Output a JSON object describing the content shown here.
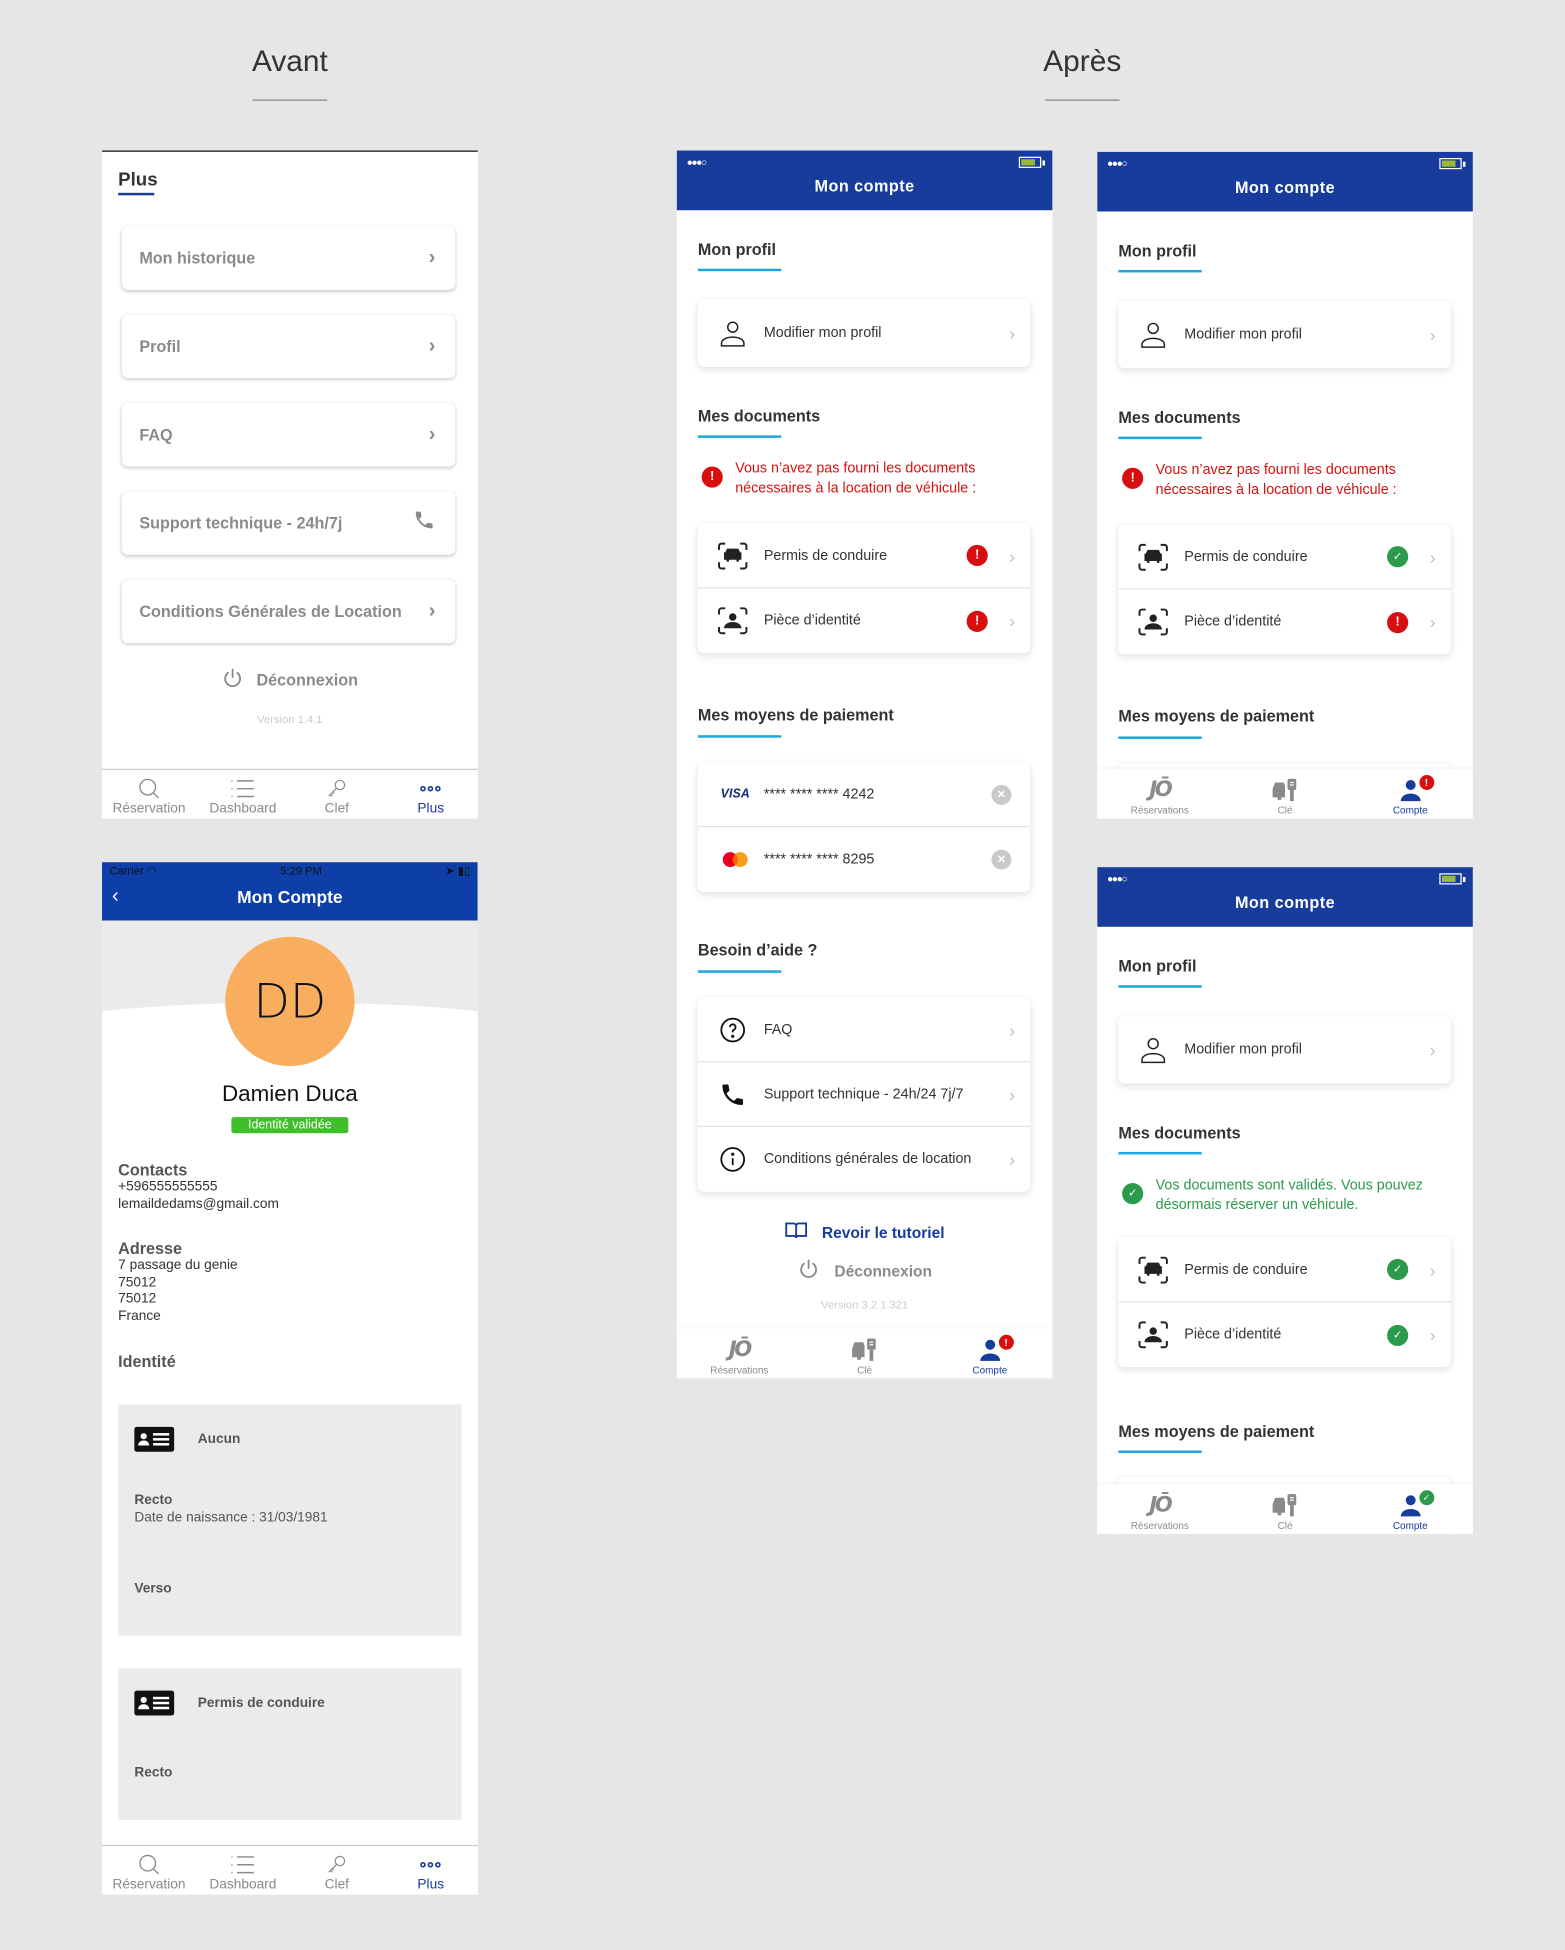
{
  "headings": {
    "before": "Avant",
    "after": "Après"
  },
  "colors": {
    "brand_blue": "#173c9c",
    "accent_cyan": "#1aa6df",
    "error_red": "#d90f0f",
    "success_green": "#2b9a4a",
    "avatar_orange": "#f9ad5f",
    "badge_green": "#3fbf2a"
  },
  "avant_plus": {
    "title": "Plus",
    "items": [
      {
        "label": "Mon historique",
        "icon": "chevron-right-icon"
      },
      {
        "label": "Profil",
        "icon": "chevron-right-icon"
      },
      {
        "label": "FAQ",
        "icon": "chevron-right-icon"
      },
      {
        "label": "Support technique - 24h/7j",
        "icon": "phone-icon"
      },
      {
        "label": "Conditions Générales de Location",
        "icon": "chevron-right-icon"
      }
    ],
    "logout": "Déconnexion",
    "version": "Version 1.4.1",
    "tabs": [
      {
        "label": "Réservation",
        "icon": "search-icon"
      },
      {
        "label": "Dashboard",
        "icon": "list-icon"
      },
      {
        "label": "Clef",
        "icon": "key-icon"
      },
      {
        "label": "Plus",
        "icon": "more-icon",
        "active": true
      }
    ]
  },
  "avant_compte": {
    "status_bar": {
      "carrier": "Carrier",
      "time": "5:29 PM"
    },
    "title": "Mon Compte",
    "avatar_initials": "DD",
    "name": "Damien Duca",
    "badge": "Identité validée",
    "contacts": {
      "heading": "Contacts",
      "phone": "+596555555555",
      "email": "lemaildedams@gmail.com"
    },
    "address": {
      "heading": "Adresse",
      "lines": [
        "7 passage du genie",
        "75012",
        "75012",
        "France"
      ]
    },
    "identity_heading": "Identité",
    "documents": [
      {
        "title": "Aucun",
        "recto_label": "Recto",
        "recto_detail": "Date de naissance : 31/03/1981",
        "verso_label": "Verso"
      },
      {
        "title": "Permis de conduire",
        "recto_label": "Recto"
      }
    ],
    "tabs": [
      {
        "label": "Réservation"
      },
      {
        "label": "Dashboard"
      },
      {
        "label": "Clef"
      },
      {
        "label": "Plus",
        "active": true
      }
    ]
  },
  "apres": {
    "header_title": "Mon compte",
    "sections": {
      "profile": "Mon profil",
      "documents": "Mes documents",
      "payment": "Mes moyens de paiement",
      "help": "Besoin d’aide ?"
    },
    "edit_profile": "Modifier mon profil",
    "doc_missing_alert": "Vous n’avez pas fourni les documents nécessaires à la location de véhicule :",
    "doc_valid_alert": "Vos documents sont validés. Vous pouvez désormais réserver un véhicule.",
    "documents": {
      "license": "Permis de conduire",
      "id": "Pièce d’identité"
    },
    "cards": [
      {
        "brand": "VISA",
        "number": "**** **** **** 4242"
      },
      {
        "brand": "mastercard",
        "number": "**** **** **** 8295"
      }
    ],
    "help_items": [
      {
        "label": "FAQ",
        "icon": "question-circle-icon"
      },
      {
        "label": "Support technique - 24h/24 7j/7",
        "icon": "phone-icon"
      },
      {
        "label": "Conditions générales de location",
        "icon": "info-circle-icon"
      }
    ],
    "tutorial": "Revoir le tutoriel",
    "logout": "Déconnexion",
    "version": "Version 3.2.1.321",
    "tabs": [
      {
        "label": "Réservations",
        "icon": "brand-logo-icon"
      },
      {
        "label": "Clé",
        "icon": "car-key-icon"
      },
      {
        "label": "Compte",
        "icon": "user-icon",
        "active": true
      }
    ],
    "screens": [
      {
        "license_status": "error",
        "id_status": "error",
        "account_badge": "error"
      },
      {
        "license_status": "ok",
        "id_status": "error",
        "account_badge": "error"
      },
      {
        "license_status": "ok",
        "id_status": "ok",
        "account_badge": "ok"
      }
    ],
    "status_glyphs": {
      "error": "!",
      "ok": "✓"
    }
  }
}
